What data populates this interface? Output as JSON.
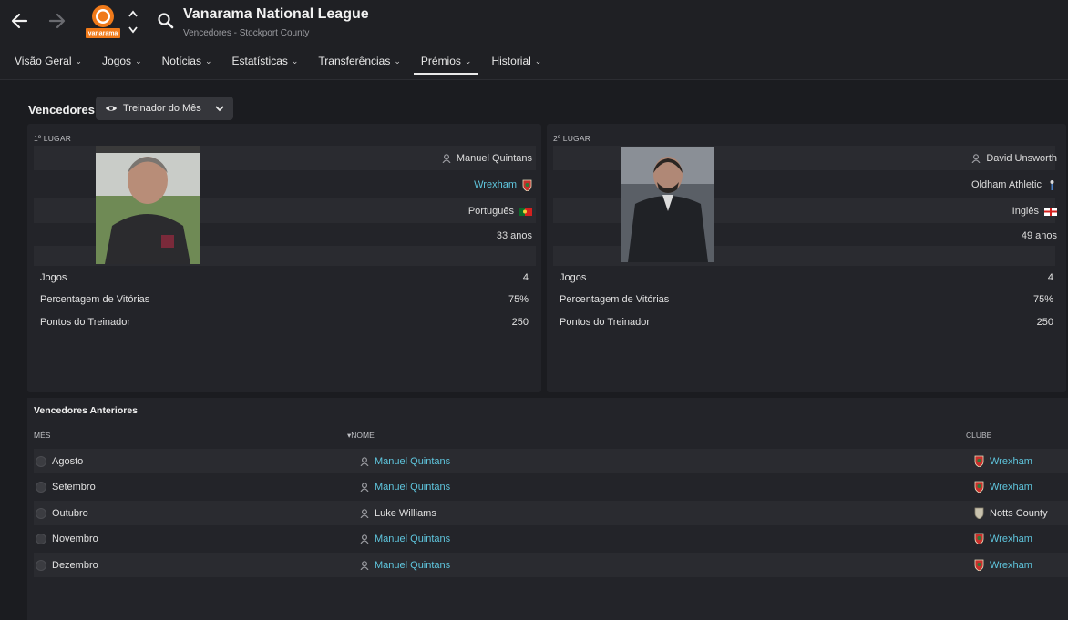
{
  "header": {
    "competition_title": "Vanarama National League",
    "subtitle": "Vencedores - Stockport County",
    "logo_text": "vanarama"
  },
  "tabs": [
    {
      "label": "Visão Geral",
      "active": false
    },
    {
      "label": "Jogos",
      "active": false
    },
    {
      "label": "Notícias",
      "active": false
    },
    {
      "label": "Estatísticas",
      "active": false
    },
    {
      "label": "Transferências",
      "active": false
    },
    {
      "label": "Prémios",
      "active": true
    },
    {
      "label": "Historial",
      "active": false
    }
  ],
  "section": {
    "title": "Vencedores",
    "dropdown_label": "Treinador do Mês"
  },
  "winners": [
    {
      "place_label": "1º LUGAR",
      "name": "Manuel Quintans",
      "club": "Wrexham",
      "club_is_link": true,
      "nationality": "Português",
      "age": "33 anos",
      "stats": [
        {
          "label": "Jogos",
          "value": "4"
        },
        {
          "label": "Percentagem de Vitórias",
          "value": "75%"
        },
        {
          "label": "Pontos do Treinador",
          "value": "250"
        }
      ]
    },
    {
      "place_label": "2º LUGAR",
      "name": "David Unsworth",
      "club": "Oldham Athletic",
      "club_is_link": false,
      "nationality": "Inglês",
      "age": "49 anos",
      "stats": [
        {
          "label": "Jogos",
          "value": "4"
        },
        {
          "label": "Percentagem de Vitórias",
          "value": "75%"
        },
        {
          "label": "Pontos do Treinador",
          "value": "250"
        }
      ]
    }
  ],
  "previous": {
    "title": "Vencedores Anteriores",
    "columns": {
      "month": "MÊS",
      "name": "NOME",
      "club": "CLUBE"
    },
    "rows": [
      {
        "month": "Agosto",
        "name": "Manuel Quintans",
        "club": "Wrexham"
      },
      {
        "month": "Setembro",
        "name": "Manuel Quintans",
        "club": "Wrexham"
      },
      {
        "month": "Outubro",
        "name": "Luke Williams",
        "club": "Notts County"
      },
      {
        "month": "Novembro",
        "name": "Manuel Quintans",
        "club": "Wrexham"
      },
      {
        "month": "Dezembro",
        "name": "Manuel Quintans",
        "club": "Wrexham"
      }
    ]
  },
  "colors": {
    "link": "#5fc6de",
    "background": "#1b1c20",
    "panel": "#232429",
    "accent_logo": "#f07a1a"
  }
}
